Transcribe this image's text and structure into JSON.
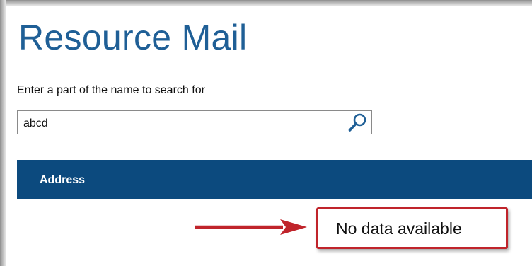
{
  "page": {
    "title": "Resource Mail"
  },
  "search": {
    "label": "Enter a part of the name to search for",
    "value": "abcd",
    "icon": "magnifier"
  },
  "grid": {
    "columns": [
      "Address"
    ],
    "empty_message": "No data available"
  },
  "annotation": {
    "arrow_icon": "right-arrow",
    "highlight_color": "#c0242b"
  },
  "colors": {
    "title": "#1f5f96",
    "header_bg": "#0c4a7e",
    "annotation_red": "#c0242b"
  }
}
